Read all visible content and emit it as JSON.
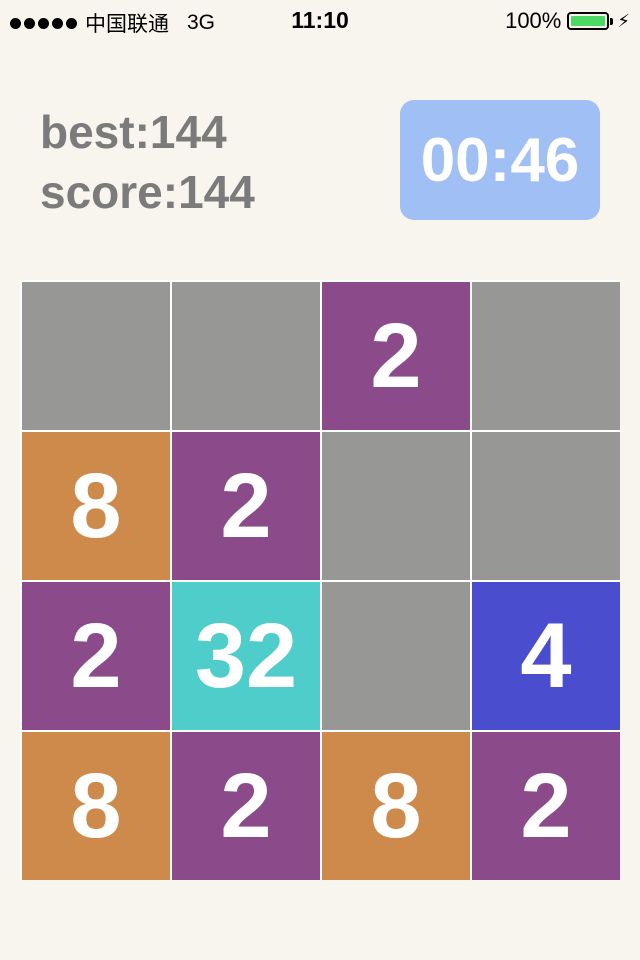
{
  "status_bar": {
    "carrier": "中国联通",
    "network": "3G",
    "time": "11:10",
    "battery_percent": "100%",
    "battery_level": 1.0,
    "icons": [
      "signal-dots-icon",
      "battery-icon",
      "charging-bolt-icon"
    ]
  },
  "scores": {
    "best": "best:144",
    "score": "score:144"
  },
  "timer": {
    "value": "00:46"
  },
  "colors": {
    "background": "#f8f5ee",
    "empty": "#979795",
    "tile_2": "#8b4b8b",
    "tile_4": "#4a4dcd",
    "tile_8": "#cd8a4a",
    "tile_32": "#4ecdcb",
    "timer_bg": "#9fbff5",
    "score_text": "#7b7b7b",
    "battery_fill": "#4cd964"
  },
  "board": {
    "rows": [
      [
        "",
        "",
        "2",
        ""
      ],
      [
        "8",
        "2",
        "",
        ""
      ],
      [
        "2",
        "32",
        "",
        "4"
      ],
      [
        "8",
        "2",
        "8",
        "2"
      ]
    ]
  }
}
